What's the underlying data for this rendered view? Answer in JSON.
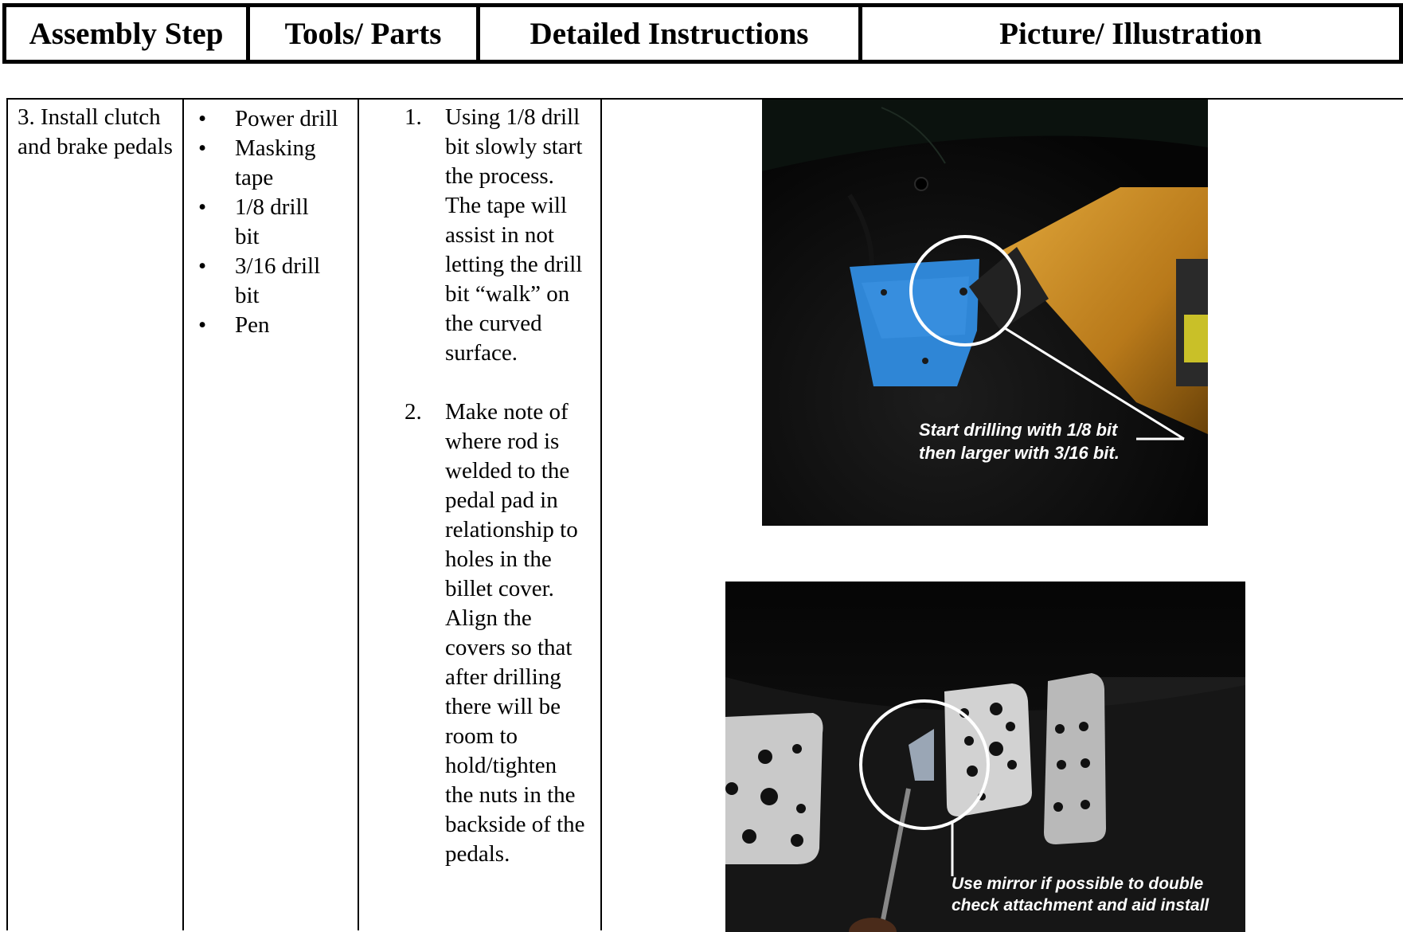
{
  "header": {
    "col1": "Assembly Step",
    "col2": "Tools/ Parts",
    "col3": "Detailed Instructions",
    "col4": "Picture/ Illustration"
  },
  "step": "3.  Install clutch and brake pedals",
  "tools": [
    "Power drill",
    "Masking tape",
    "1/8 drill bit",
    "3/16 drill bit",
    "Pen"
  ],
  "instructions": [
    {
      "num": "1.",
      "text": "Using 1/8 drill bit slowly start the process. The tape will assist in not letting the drill bit “walk” on the curved surface."
    },
    {
      "num": "2.",
      "text": "Make note of where rod is welded to the pedal pad in relationship to holes in the billet cover. Align the covers so that after drilling there will be room to hold/tighten the nuts in the backside of the pedals."
    }
  ],
  "photos": {
    "photo1_caption": [
      "Start drilling with 1/8 bit",
      "then larger with 3/16 bit."
    ],
    "photo2_caption": [
      "Use mirror if possible to double",
      "check attachment and aid install"
    ]
  },
  "colors": {
    "tape_blue": "#2f86d6",
    "drill_yellow": "#c98a1f",
    "pedal_silver": "#c9c9c9",
    "background_dark": "#060606"
  }
}
